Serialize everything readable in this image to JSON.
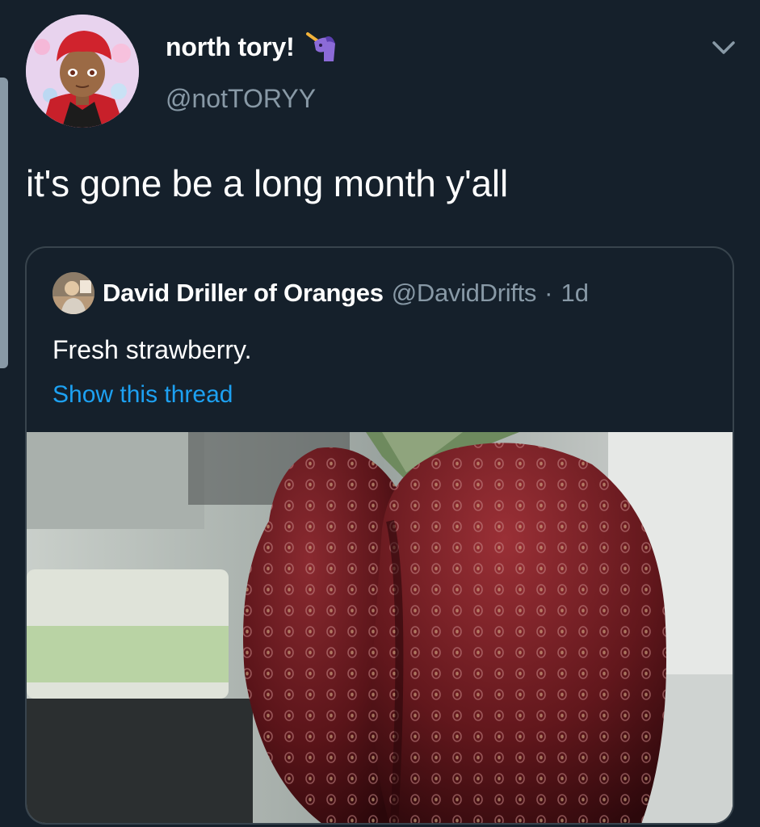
{
  "tweet": {
    "display_name": "north tory!",
    "handle": "@notTORYY",
    "text": "it's gone be a long month y'all",
    "badge_icon": "unicorn-icon",
    "menu_icon": "chevron-down-icon"
  },
  "quoted_tweet": {
    "display_name": "David Driller of Oranges",
    "handle": "@DavidDrifts",
    "separator": "·",
    "time": "1d",
    "text": "Fresh strawberry.",
    "show_thread_label": "Show this thread",
    "media_icon": "strawberry-photo"
  },
  "colors": {
    "background": "#15202b",
    "secondary_text": "#8899a6",
    "link": "#1da1f2",
    "border": "#38444d"
  }
}
